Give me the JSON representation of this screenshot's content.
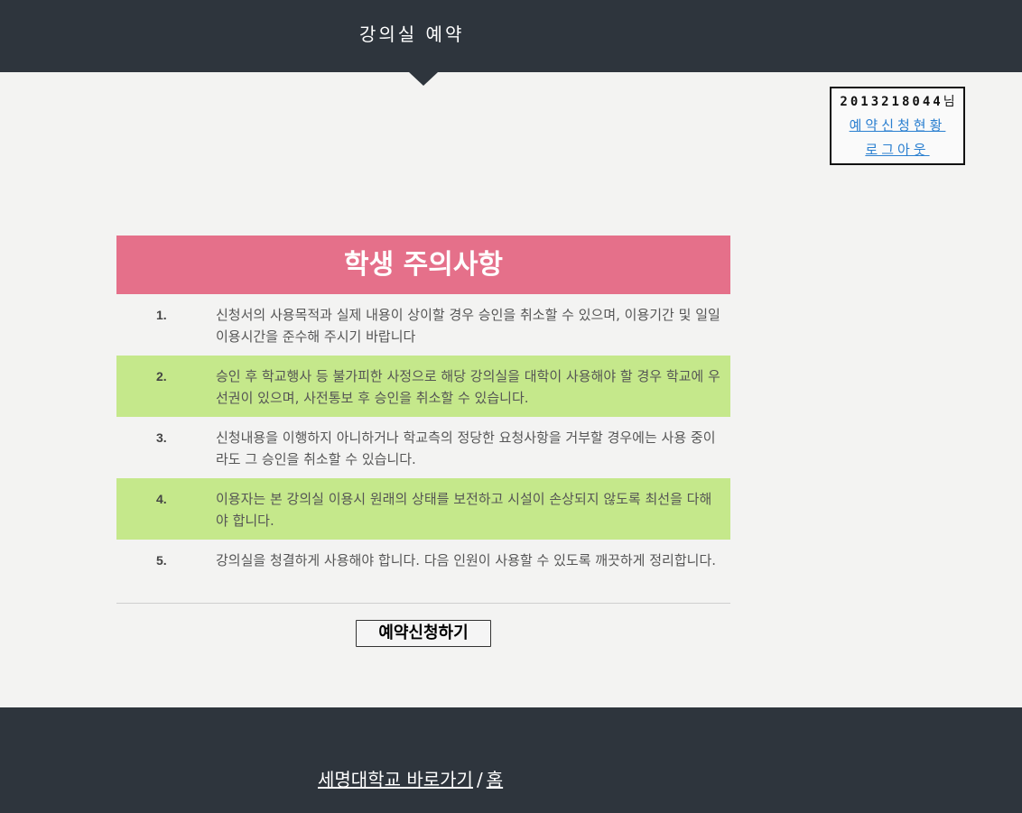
{
  "header": {
    "title": "강의실  예약"
  },
  "user": {
    "id": "2013218044",
    "suffix": "님",
    "status_link": "예약신청현황",
    "logout_link": "로그아웃"
  },
  "notice": {
    "title": "학생 주의사항",
    "items": [
      {
        "num": "1.",
        "text": "신청서의 사용목적과 실제 내용이 상이할 경우 승인을 취소할 수 있으며, 이용기간 및 일일 이용시간을 준수해 주시기 바랍니다"
      },
      {
        "num": "2.",
        "text": "승인 후 학교행사 등 불가피한 사정으로 해당 강의실을 대학이 사용해야 할 경우 학교에 우선권이 있으며, 사전통보 후 승인을 취소할 수 있습니다."
      },
      {
        "num": "3.",
        "text": "신청내용을 이행하지 아니하거나 학교측의 정당한 요청사항을 거부할 경우에는 사용 중이라도 그 승인을 취소할 수 있습니다."
      },
      {
        "num": "4.",
        "text": "이용자는 본 강의실 이용시 원래의 상태를 보전하고 시설이 손상되지 않도록 최선을 다해야 합니다."
      },
      {
        "num": "5.",
        "text": "강의실을 청결하게 사용해야 합니다. 다음 인원이 사용할 수 있도록 깨끗하게 정리합니다."
      }
    ]
  },
  "apply_button": "예약신청하기",
  "footer": {
    "university_link": "세명대학교 바로가기",
    "separator": "/",
    "home_link": "홈"
  },
  "colors": {
    "header_bg": "#2e353d",
    "title_bg": "#e5708a",
    "row_highlight": "#c5e88b",
    "link": "#2a7fd0"
  }
}
